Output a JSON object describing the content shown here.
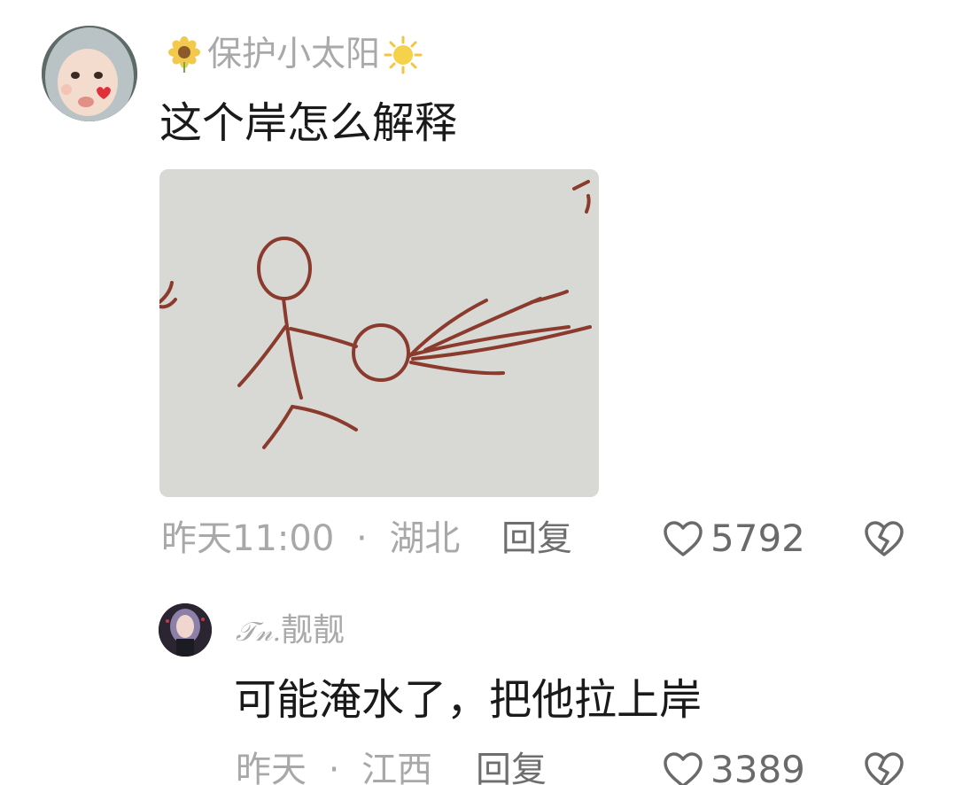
{
  "comments": [
    {
      "username": "保护小太阳",
      "username_decorations": [
        "sunflower-icon",
        "sun-icon"
      ],
      "text": "这个岸怎么解释",
      "attachment": "stick-figure-drawing",
      "time": "昨天11:00",
      "separator": "·",
      "location": "湖北",
      "reply_label": "回复",
      "likes": "5792"
    },
    {
      "username_prefix": "𝒯𝓃.",
      "username": "靓靓",
      "text": "可能淹水了，把他拉上岸",
      "time": "昨天",
      "separator": "·",
      "location": "江西",
      "reply_label": "回复",
      "likes": "3389"
    }
  ],
  "colors": {
    "username": "#a9a9a9",
    "text": "#1a1a1a",
    "meta": "#a8a8a8",
    "action": "#6a6a6a",
    "drawing_ink": "#8a3b2e",
    "image_bg": "#d8d9d4"
  }
}
